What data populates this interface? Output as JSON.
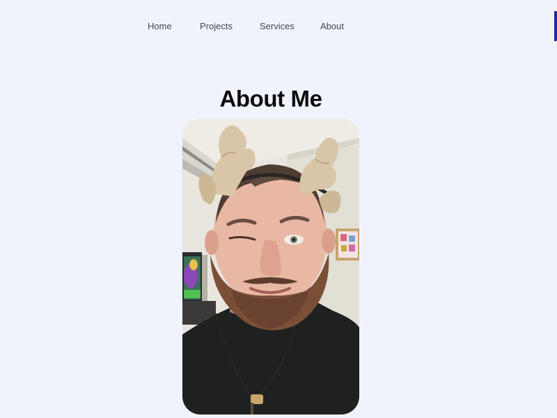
{
  "nav": {
    "items": [
      {
        "label": "Home"
      },
      {
        "label": "Projects"
      },
      {
        "label": "Services"
      },
      {
        "label": "About"
      }
    ]
  },
  "main": {
    "title": "About Me",
    "photo_alt": "Portrait photo"
  },
  "colors": {
    "background": "#f1f3fc",
    "accent": "#1d2aa3",
    "title": "#0c0c12",
    "nav_text": "#444456"
  }
}
